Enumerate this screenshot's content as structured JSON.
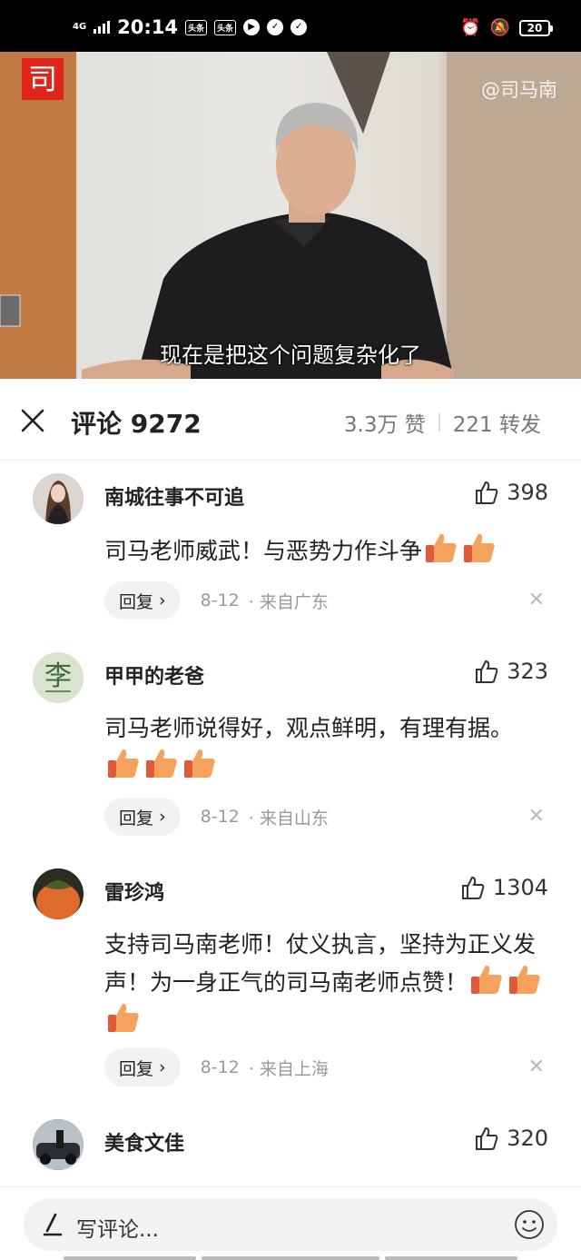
{
  "status_bar": {
    "network": "4G",
    "time": "20:14",
    "app_badges": [
      "头条",
      "头条"
    ],
    "battery": "20"
  },
  "video": {
    "watermark": "@司马南",
    "subtitle": "现在是把这个问题复杂化了",
    "logo_char": "司"
  },
  "comments_header": {
    "title": "评论 9272",
    "likes": "3.3万 赞",
    "shares": "221 转发"
  },
  "comments": [
    {
      "name": "南城往事不可追",
      "likes": "398",
      "text": "司马老师威武！与恶势力作斗争",
      "thumbs": 2,
      "reply": "回复",
      "date": "8-12",
      "location": "· 来自广东"
    },
    {
      "name": "甲甲的老爸",
      "likes": "323",
      "text": "司马老师说得好，观点鲜明，有理有据。",
      "thumbs": 3,
      "reply": "回复",
      "date": "8-12",
      "location": "· 来自山东",
      "avatar_char": "李"
    },
    {
      "name": "雷珍鸿",
      "likes": "1304",
      "text": "支持司马南老师！仗义执言，坚持为正义发声！为一身正气的司马南老师点赞！",
      "thumbs": 3,
      "reply": "回复",
      "date": "8-12",
      "location": "· 来自上海"
    },
    {
      "name": "美食文佳",
      "likes": "320"
    }
  ],
  "input": {
    "placeholder": "写评论..."
  },
  "icons": {
    "close": "close-icon",
    "like": "thumbs-up-outline-icon",
    "thumb_emoji": "thumbs-up-emoji-icon",
    "pen": "pen-icon",
    "emoji": "smiley-icon",
    "chevron": "chevron-right-icon",
    "dismiss": "close-icon"
  },
  "colors": {
    "brand_red": "#e1251b",
    "secondary_text": "#999999",
    "thumb_orange": "#f5a25d"
  }
}
